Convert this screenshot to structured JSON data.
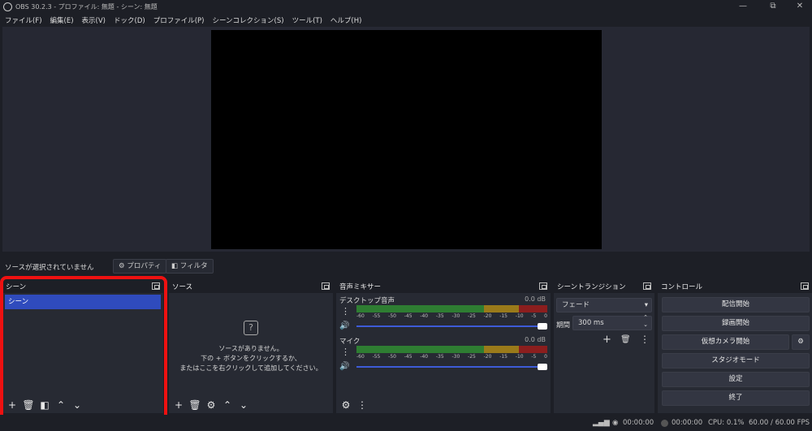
{
  "window": {
    "title": "OBS 30.2.3 - プロファイル: 無題 - シーン: 無題",
    "minimize": "—",
    "restore": "⧉",
    "close": "✕"
  },
  "menu": [
    "ファイル(F)",
    "編集(E)",
    "表示(V)",
    "ドック(D)",
    "プロファイル(P)",
    "シーンコレクション(S)",
    "ツール(T)",
    "ヘルプ(H)"
  ],
  "source_toolbar": {
    "no_source": "ソースが選択されていません",
    "properties": "プロパティ",
    "filters": "フィルタ"
  },
  "scenes": {
    "title": "シーン",
    "items": [
      "シーン"
    ]
  },
  "sources": {
    "title": "ソース",
    "empty_line1": "ソースがありません。",
    "empty_line2": "下の + ボタンをクリックするか、",
    "empty_line3": "またはここを右クリックして追加してください。"
  },
  "mixer": {
    "title": "音声ミキサー",
    "channels": [
      {
        "name": "デスクトップ音声",
        "db": "0.0 dB"
      },
      {
        "name": "マイク",
        "db": "0.0 dB"
      }
    ],
    "scale": [
      "-60",
      "-55",
      "-50",
      "-45",
      "-40",
      "-35",
      "-30",
      "-25",
      "-20",
      "-15",
      "-10",
      "-5",
      "0"
    ]
  },
  "transitions": {
    "title": "シーントランジション",
    "selected": "フェード",
    "duration_label": "期間",
    "duration_value": "300 ms"
  },
  "controls": {
    "title": "コントロール",
    "start_streaming": "配信開始",
    "start_recording": "録画開始",
    "virtual_camera": "仮想カメラ開始",
    "studio_mode": "スタジオモード",
    "settings": "設定",
    "exit": "終了"
  },
  "status": {
    "stream_time": "00:00:00",
    "record_time": "00:00:00",
    "cpu": "CPU: 0.1%",
    "fps": "60.00 / 60.00 FPS"
  },
  "colors": {
    "highlight": "#ee1111",
    "selected_scene": "#2f4bbd",
    "meter_green": "#2e7d32",
    "meter_yellow": "#9a7a1a",
    "meter_red": "#8b1e1e"
  }
}
